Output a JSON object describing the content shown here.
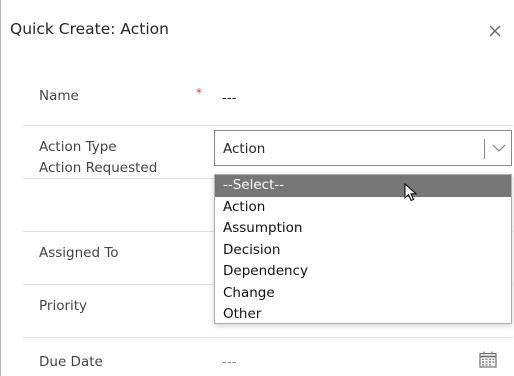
{
  "dialog": {
    "title": "Quick Create: Action",
    "close_icon": "close-icon"
  },
  "fields": {
    "name": {
      "label": "Name",
      "required_marker": "*",
      "value": "---"
    },
    "action_type": {
      "label": "Action Type",
      "value": "Action",
      "options": [
        "--Select--",
        "Action",
        "Assumption",
        "Decision",
        "Dependency",
        "Change",
        "Other"
      ],
      "highlighted_option": "--Select--"
    },
    "action_requested": {
      "label": "Action Requested"
    },
    "assigned_to": {
      "label": "Assigned To"
    },
    "priority": {
      "label": "Priority"
    },
    "due_date": {
      "label": "Due Date",
      "value": "---",
      "icon": "calendar-icon"
    }
  },
  "colors": {
    "required": "#d6403a",
    "highlight_bg": "#767676",
    "divider": "#e1e1e1"
  }
}
